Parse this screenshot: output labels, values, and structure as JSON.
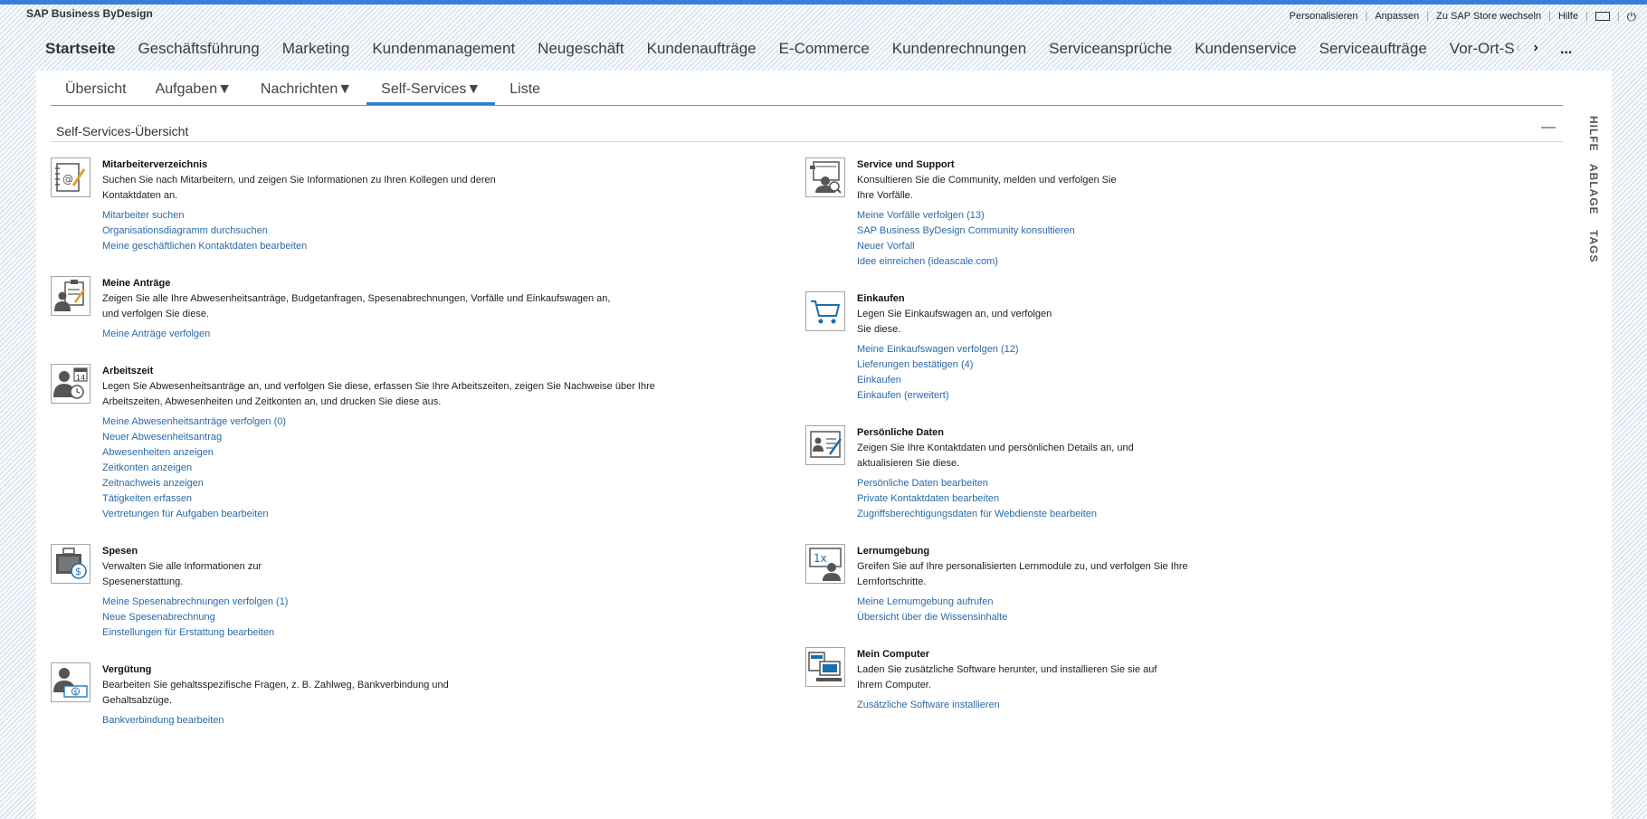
{
  "app": {
    "title": "SAP Business ByDesign"
  },
  "toplinks": {
    "personalize": "Personalisieren",
    "customize": "Anpassen",
    "store": "Zu SAP Store wechseln",
    "help": "Hilfe",
    "icons": [
      "screen-icon",
      "power-icon"
    ]
  },
  "mainnav": {
    "items": [
      "Startseite",
      "Geschäftsführung",
      "Marketing",
      "Kundenmanagement",
      "Neugeschäft",
      "Kundenaufträge",
      "E-Commerce",
      "Kundenrechnungen",
      "Serviceansprüche",
      "Kundenservice",
      "Serviceaufträge",
      "Vor-Ort-S"
    ],
    "active": "Startseite",
    "prev": "‹",
    "next": "›",
    "more": "..."
  },
  "subtabs": {
    "items": [
      "Übersicht",
      "Aufgaben▼",
      "Nachrichten▼",
      "Self-Services▼",
      "Liste"
    ],
    "active": "Self-Services▼"
  },
  "section": {
    "title": "Self-Services-Übersicht",
    "collapse": "—"
  },
  "left": [
    {
      "icon": "directory-icon",
      "title": "Mitarbeiterverzeichnis",
      "desc": [
        "Suchen Sie nach Mitarbeitern, und zeigen Sie Informationen zu Ihren Kollegen und deren",
        "Kontaktdaten an."
      ],
      "links": [
        "Mitarbeiter suchen",
        "Organisationsdiagramm durchsuchen",
        "Meine geschäftlichen Kontaktdaten bearbeiten"
      ]
    },
    {
      "icon": "requests-icon",
      "title": "Meine Anträge",
      "desc": [
        "Zeigen Sie alle Ihre Abwesenheitsanträge, Budgetanfragen, Spesenabrechnungen, Vorfälle und Einkaufswagen an,",
        "und verfolgen Sie diese."
      ],
      "links": [
        "Meine Anträge verfolgen"
      ]
    },
    {
      "icon": "worktime-icon",
      "title": "Arbeitszeit",
      "desc": [
        "Legen Sie Abwesenheitsanträge an, und verfolgen Sie diese, erfassen Sie Ihre Arbeitszeiten, zeigen Sie Nachweise über Ihre",
        "Arbeitszeiten, Abwesenheiten und Zeitkonten an, und drucken Sie diese aus."
      ],
      "links": [
        "Meine Abwesenheitsanträge verfolgen (0)",
        "Neuer Abwesenheitsantrag",
        "Abwesenheiten anzeigen",
        "Zeitkonten anzeigen",
        "Zeitnachweis anzeigen",
        "Tätigkeiten erfassen",
        "Vertretungen für Aufgaben bearbeiten"
      ]
    },
    {
      "icon": "expenses-icon",
      "title": "Spesen",
      "desc": [
        "Verwalten Sie alle Informationen zur",
        "Spesenerstattung."
      ],
      "links": [
        "Meine Spesenabrechnungen verfolgen (1)",
        "Neue Spesenabrechnung",
        "Einstellungen für Erstattung bearbeiten"
      ]
    },
    {
      "icon": "compensation-icon",
      "title": "Vergütung",
      "desc": [
        "Bearbeiten Sie gehaltsspezifische Fragen, z. B. Zahlweg, Bankverbindung und",
        "Gehaltsabzüge."
      ],
      "links": [
        "Bankverbindung bearbeiten"
      ]
    }
  ],
  "right": [
    {
      "icon": "support-icon",
      "title": "Service und Support",
      "desc": [
        "Konsultieren Sie die Community, melden und verfolgen Sie",
        "Ihre Vorfälle."
      ],
      "links": [
        "Meine Vorfälle verfolgen (13)",
        "SAP Business ByDesign Community konsultieren",
        "Neuer Vorfall",
        "Idee einreichen (ideascale.com)"
      ]
    },
    {
      "icon": "cart-icon",
      "title": "Einkaufen",
      "desc": [
        "Legen Sie Einkaufswagen an, und verfolgen",
        "Sie diese."
      ],
      "links": [
        "Meine Einkaufswagen verfolgen (12)",
        "Lieferungen bestätigen (4)",
        "Einkaufen",
        "Einkaufen (erweitert)"
      ]
    },
    {
      "icon": "personal-data-icon",
      "title": "Persönliche Daten",
      "desc": [
        "Zeigen Sie Ihre Kontaktdaten und persönlichen Details an, und",
        "aktualisieren Sie diese."
      ],
      "links": [
        "Persönliche Daten bearbeiten",
        "Private Kontaktdaten bearbeiten",
        "Zugriffsberechtigungsdaten für Webdienste bearbeiten"
      ]
    },
    {
      "icon": "learning-icon",
      "title": "Lernumgebung",
      "desc": [
        "Greifen Sie auf Ihre personalisierten Lernmodule zu, und verfolgen Sie Ihre",
        "Lernfortschritte."
      ],
      "links": [
        "Meine Lernumgebung aufrufen",
        "Übersicht über die Wissensinhalte"
      ]
    },
    {
      "icon": "computer-icon",
      "title": "Mein Computer",
      "desc": [
        "Laden Sie zusätzliche Software herunter, und installieren Sie sie auf",
        "Ihrem Computer."
      ],
      "links": [
        "Zusätzliche Software installieren"
      ]
    }
  ],
  "icon_text": {
    "calendar_day": "14",
    "learning_label": "1x"
  },
  "sidepanel": {
    "help": "HILFE",
    "storage": "ABLAGE",
    "tags": "TAGS"
  },
  "colors": {
    "accent": "#3a7fd5",
    "link": "#2a6aa6"
  }
}
